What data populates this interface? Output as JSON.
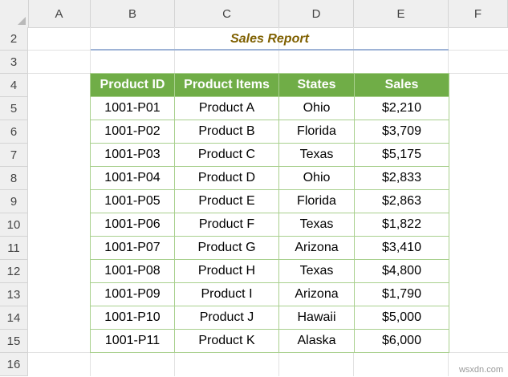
{
  "columns": [
    "A",
    "B",
    "C",
    "D",
    "E",
    "F"
  ],
  "rows": [
    "2",
    "3",
    "4",
    "5",
    "6",
    "7",
    "8",
    "9",
    "10",
    "11",
    "12",
    "13",
    "14",
    "15",
    "16"
  ],
  "title": "Sales Report",
  "table": {
    "headers": [
      "Product ID",
      "Product Items",
      "States",
      "Sales"
    ],
    "rows": [
      [
        "1001-P01",
        "Product A",
        "Ohio",
        "$2,210"
      ],
      [
        "1001-P02",
        "Product B",
        "Florida",
        "$3,709"
      ],
      [
        "1001-P03",
        "Product C",
        "Texas",
        "$5,175"
      ],
      [
        "1001-P04",
        "Product D",
        "Ohio",
        "$2,833"
      ],
      [
        "1001-P05",
        "Product E",
        "Florida",
        "$2,863"
      ],
      [
        "1001-P06",
        "Product F",
        "Texas",
        "$1,822"
      ],
      [
        "1001-P07",
        "Product G",
        "Arizona",
        "$3,410"
      ],
      [
        "1001-P08",
        "Product H",
        "Texas",
        "$4,800"
      ],
      [
        "1001-P09",
        "Product I",
        "Arizona",
        "$1,790"
      ],
      [
        "1001-P10",
        "Product J",
        "Hawaii",
        "$5,000"
      ],
      [
        "1001-P11",
        "Product K",
        "Alaska",
        "$6,000"
      ]
    ]
  },
  "watermark": "wsxdn.com",
  "colors": {
    "header_fill": "#70ad47",
    "border": "#a9d08e",
    "title": "#7f6000",
    "title_rule": "#9eb3d6"
  }
}
